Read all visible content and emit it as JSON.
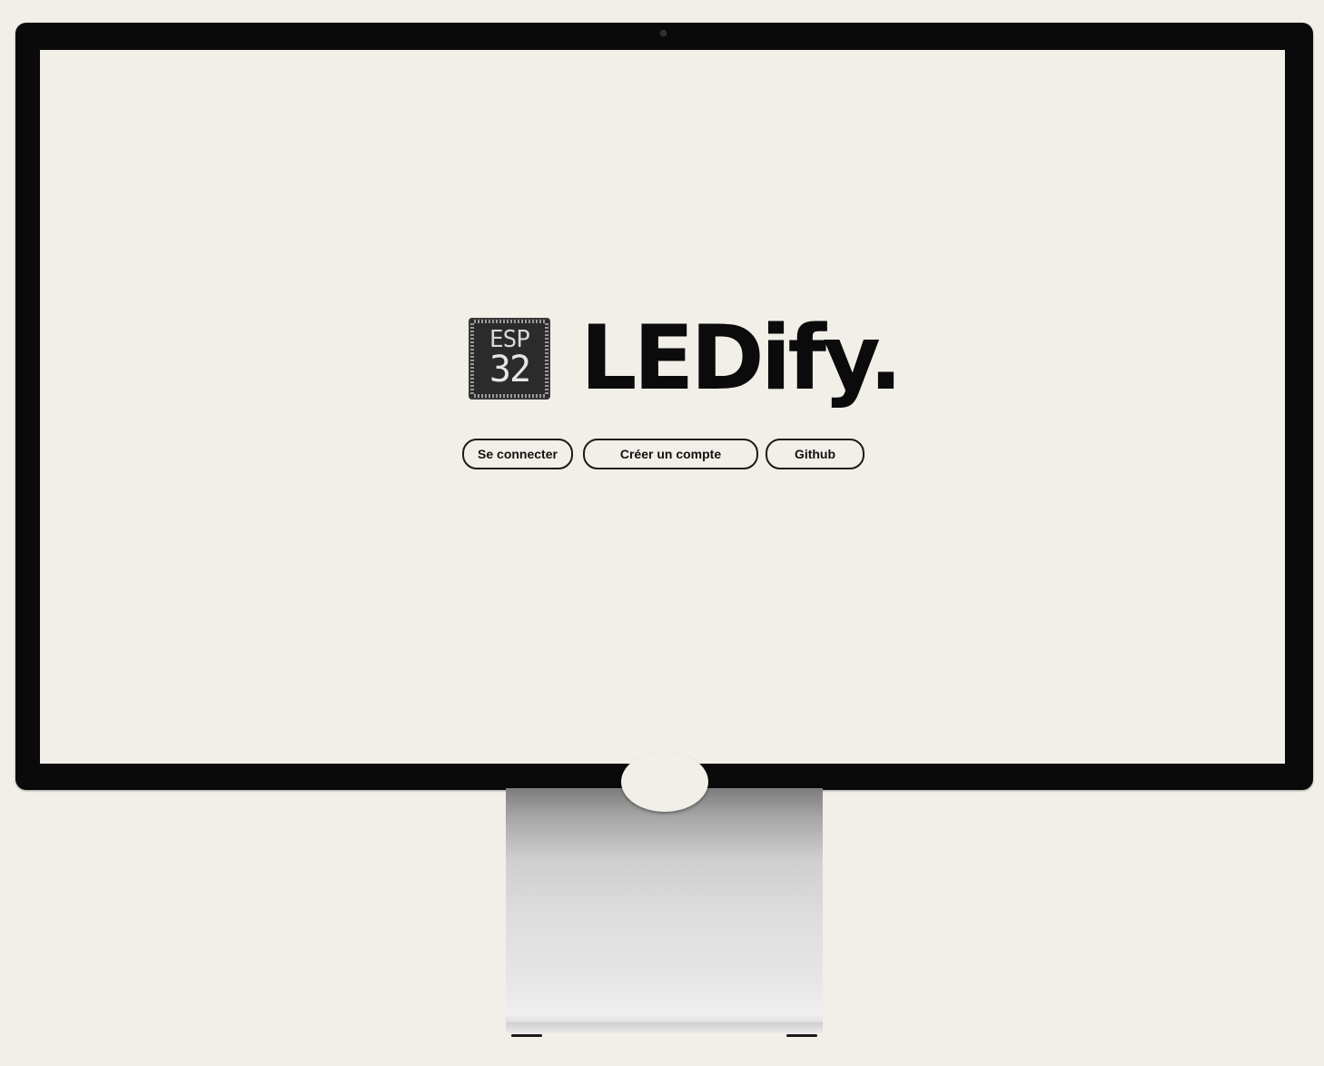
{
  "app": {
    "brand_name": "LEDify.",
    "logo": {
      "icon": "esp32-chip-icon",
      "line1": "ESP",
      "line2": "32"
    }
  },
  "actions": {
    "login_label": "Se connecter",
    "signup_label": "Créer un compte",
    "github_label": "Github"
  },
  "colors": {
    "background": "#f2efe8",
    "bezel": "#0a0a0a",
    "text": "#0b0b0b"
  }
}
